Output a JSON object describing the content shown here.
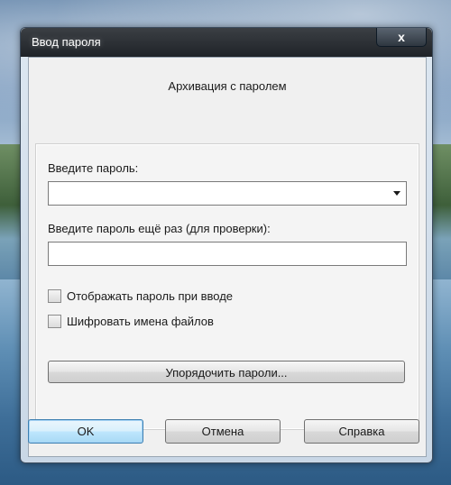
{
  "window": {
    "title": "Ввод пароля",
    "close_label": "x"
  },
  "dialog": {
    "subtitle": "Архивация с паролем"
  },
  "password": {
    "label": "Введите пароль:",
    "value": ""
  },
  "confirm": {
    "label": "Введите пароль ещё раз (для проверки):",
    "value": ""
  },
  "options": {
    "show_password": {
      "label": "Отображать пароль при вводе",
      "checked": false
    },
    "encrypt_names": {
      "label": "Шифровать имена файлов",
      "checked": false
    }
  },
  "buttons": {
    "organize": "Упорядочить пароли...",
    "ok": "OK",
    "cancel": "Отмена",
    "help": "Справка"
  },
  "icons": {
    "close": "close-icon",
    "combo_arrow": "chevron-down-icon"
  }
}
